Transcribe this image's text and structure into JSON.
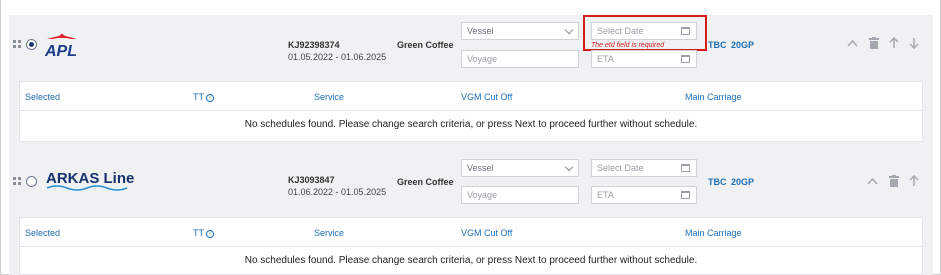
{
  "rows": [
    {
      "logo_text": "APL",
      "reference": "KJ92398374",
      "date_range": "01.05.2022 - 01.06.2025",
      "commodity": "Green Coffee",
      "vessel_placeholder": "Vessel",
      "voyage_placeholder": "Voyage",
      "etd_placeholder": "Select Date",
      "eta_placeholder": "ETA",
      "etd_error": "The etd field is required",
      "status": "TBC",
      "equipment": "20GP",
      "selected": true
    },
    {
      "logo_text": "ARKAS Line",
      "reference": "KJ3093847",
      "date_range": "01.06.2022 - 01.05.2025",
      "commodity": "Green Coffee",
      "vessel_placeholder": "Vessel",
      "voyage_placeholder": "Voyage",
      "etd_placeholder": "Select Date",
      "eta_placeholder": "ETA",
      "status": "TBC",
      "equipment": "20GP",
      "selected": false
    }
  ],
  "schedule_headers": {
    "selected": "Selected",
    "tt": "TT",
    "service": "Service",
    "vgm_cut_off": "VGM Cut Off",
    "main_carriage": "Main Carriage"
  },
  "no_schedules_message": "No schedules found. Please change search criteria, or press Next to proceed further without schedule.",
  "icons": {
    "info": "info-icon",
    "collapse": "chevron-up-icon",
    "delete": "trash-icon",
    "move_up": "arrow-up-icon",
    "move_down": "arrow-down-icon",
    "calendar": "calendar-icon",
    "drag": "drag-handle-icon"
  },
  "colors": {
    "link": "#1f6fb7",
    "error": "#d71b1b",
    "apl_blue": "#1c3d8c",
    "apl_red": "#e0262a",
    "arkas_blue": "#14336e"
  }
}
